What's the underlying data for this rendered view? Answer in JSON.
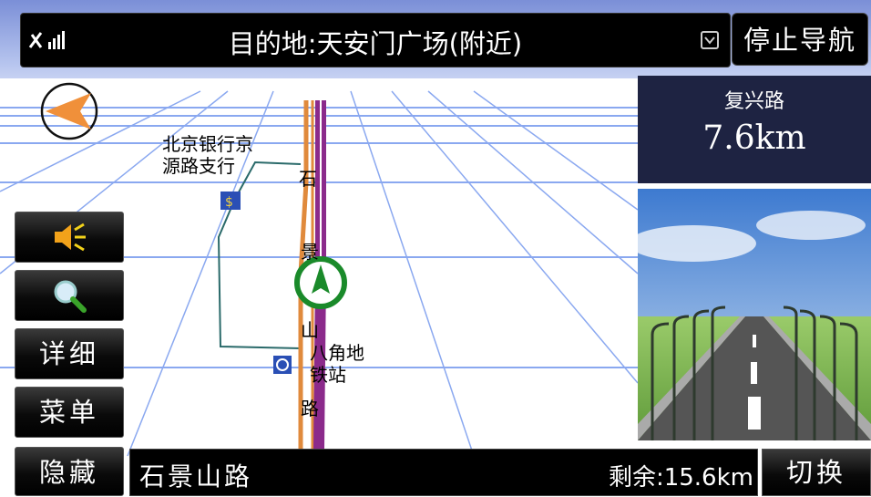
{
  "topbar": {
    "destination": "目的地:天安门广场(附近)",
    "stop_label": "停止导航"
  },
  "next_turn": {
    "road": "复兴路",
    "distance": "7.6km"
  },
  "map": {
    "poi_bank": "北京银行京\n源路支行",
    "station": "八角地\n铁站",
    "street_chars": [
      "石",
      "景",
      "山",
      "路"
    ]
  },
  "buttons": {
    "volume_icon": "speaker-icon",
    "search_icon": "magnifier-icon",
    "detail": "详细",
    "menu": "菜单",
    "hide": "隐藏",
    "switch": "切换"
  },
  "bottombar": {
    "current_road": "石景山路",
    "remaining": "剩余:15.6km"
  },
  "colors": {
    "route": "#8b2a8b",
    "road_orange": "#e08a3c",
    "position_ring": "#1a8a2a",
    "panel": "#1e2342"
  }
}
